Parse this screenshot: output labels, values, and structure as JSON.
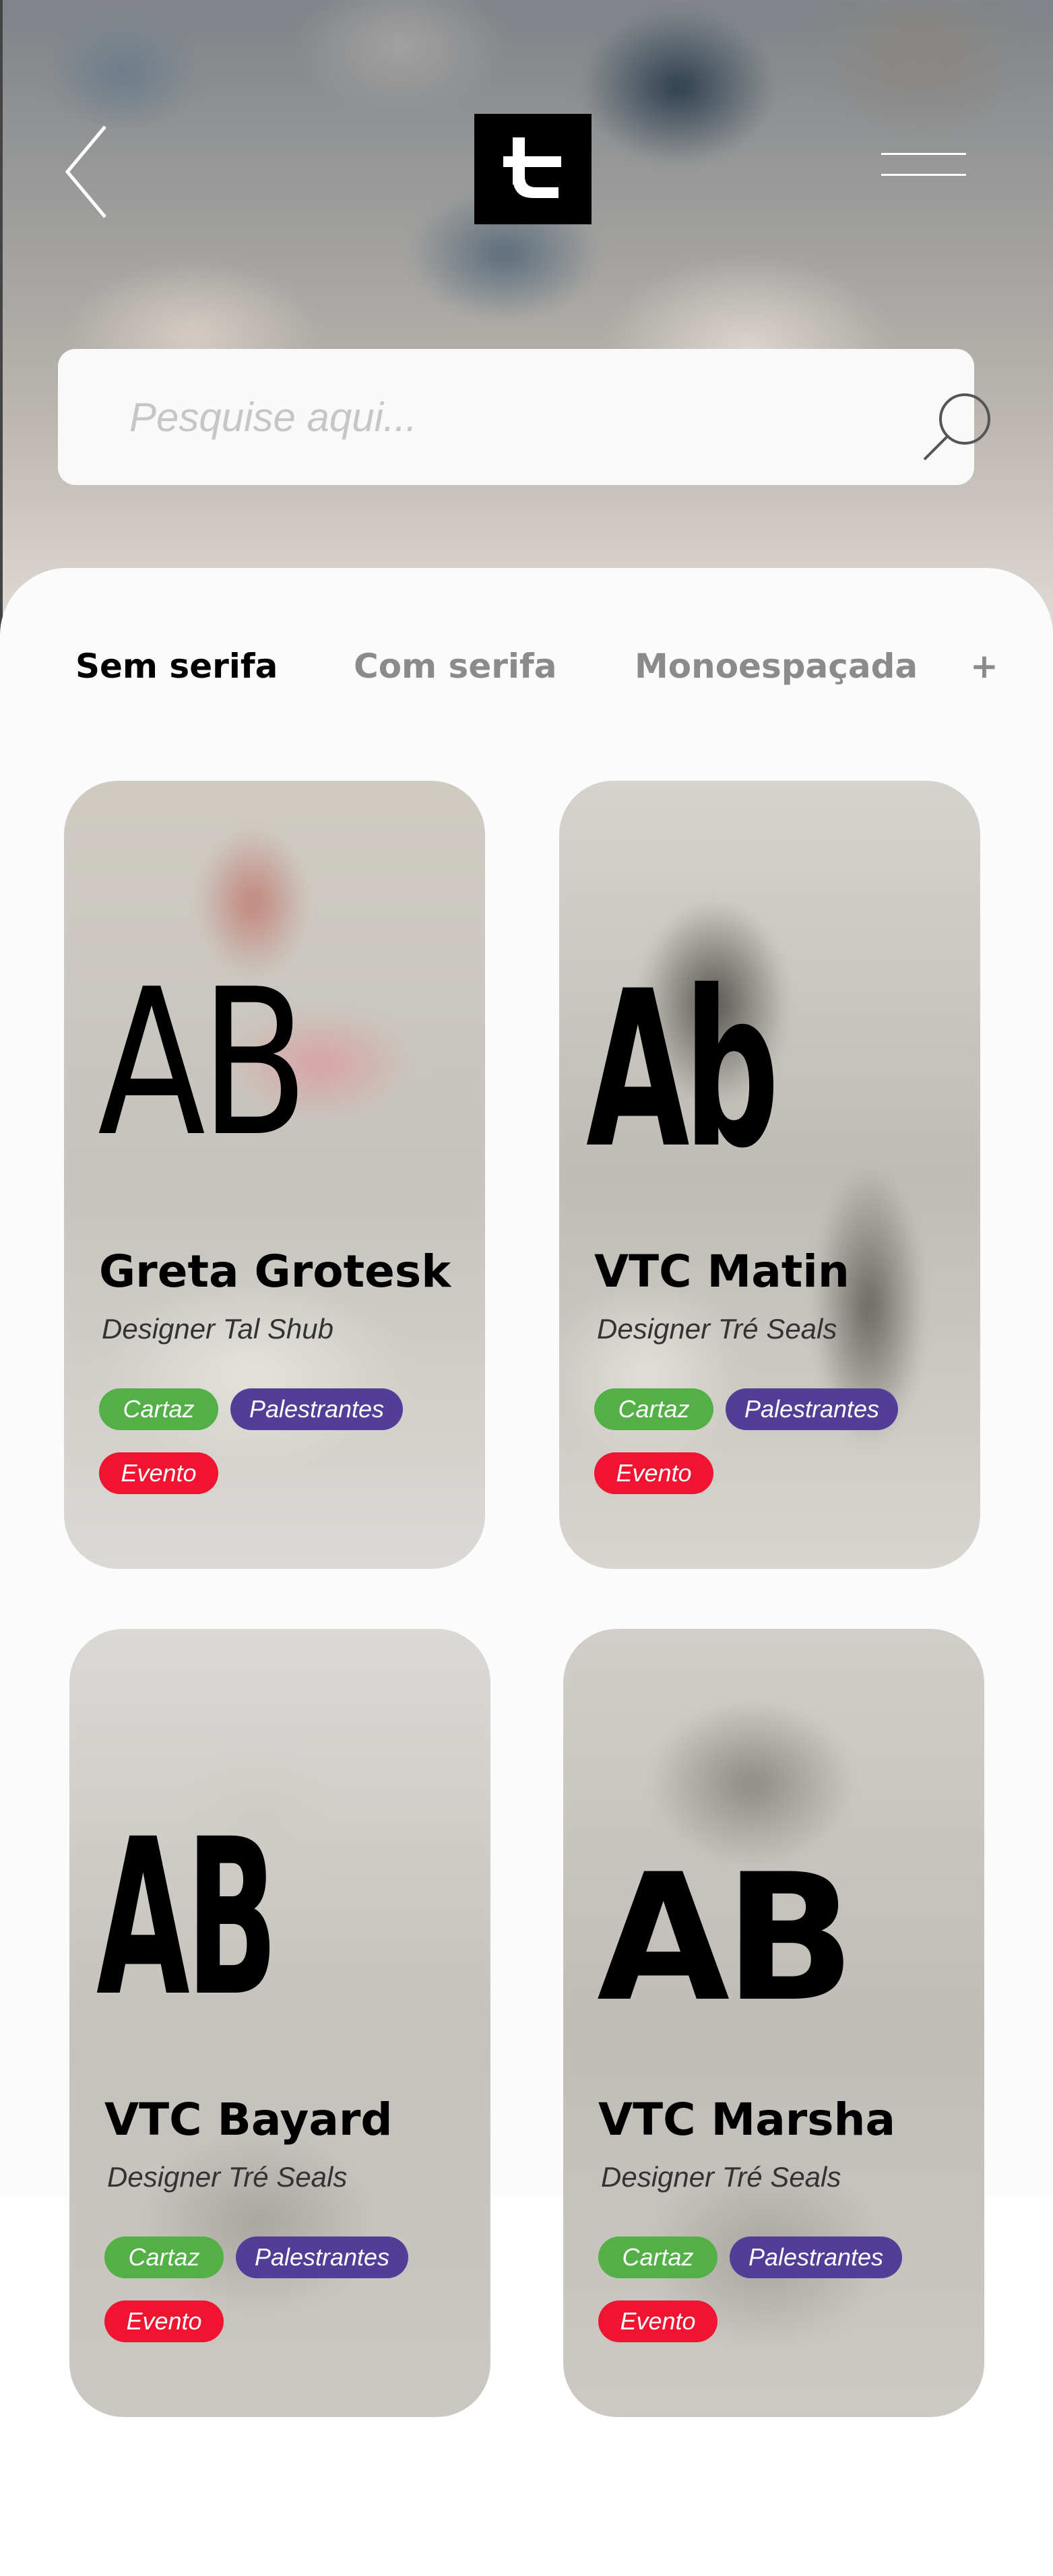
{
  "header": {
    "logo_letter": "t",
    "search_placeholder": "Pesquise aqui..."
  },
  "tabs": [
    {
      "label": "Sem serifa",
      "active": true
    },
    {
      "label": "Com serifa",
      "active": false
    },
    {
      "label": "Monoespaçada",
      "active": false
    },
    {
      "label": "+",
      "active": false
    }
  ],
  "cards": [
    {
      "sample": "AB",
      "name": "Greta Grotesk",
      "designer": "Designer Tal Shub",
      "tags": [
        "Cartaz",
        "Palestrantes",
        "Evento"
      ]
    },
    {
      "sample": "Ab",
      "name": "VTC Matin",
      "designer": "Designer Tré Seals",
      "tags": [
        "Cartaz",
        "Palestrantes",
        "Evento"
      ]
    },
    {
      "sample": "AB",
      "name": "VTC Bayard",
      "designer": "Designer Tré Seals",
      "tags": [
        "Cartaz",
        "Palestrantes",
        "Evento"
      ]
    },
    {
      "sample": "AB",
      "name": "VTC Marsha",
      "designer": "Designer Tré Seals",
      "tags": [
        "Cartaz",
        "Palestrantes",
        "Evento"
      ]
    }
  ],
  "colors": {
    "tag_cartaz": "#52b046",
    "tag_palestrantes": "#523e96",
    "tag_evento": "#f01430"
  }
}
